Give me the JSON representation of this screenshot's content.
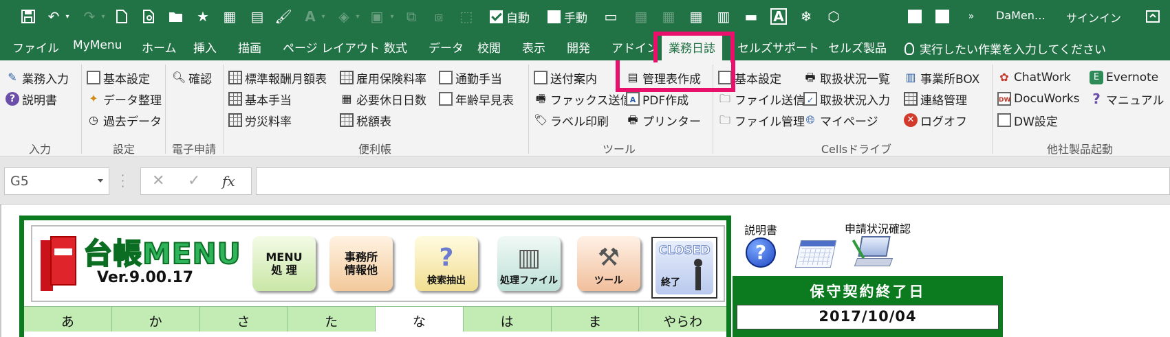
{
  "qat": {
    "checkbox_auto": "自動",
    "checkbox_manual": "手動",
    "account_name": "DaMen…",
    "signin": "サインイン"
  },
  "tabs": [
    "ファイル",
    "MyMenu",
    "ホーム",
    "挿入",
    "描画",
    "ページ レイアウト",
    "数式",
    "データ",
    "校閲",
    "表示",
    "開発",
    "アドイン",
    "業務日誌",
    "セルズサポート",
    "セルズ製品"
  ],
  "active_tab": "業務日誌",
  "tellme": "実行したい作業を入力してください",
  "ribbon": {
    "input": {
      "label": "入力",
      "items": [
        "業務入力",
        "説明書"
      ]
    },
    "settings": {
      "label": "設定",
      "items": [
        "基本設定",
        "データ整理",
        "過去データ"
      ]
    },
    "eapply": {
      "label": "電子申請",
      "items": [
        "確認"
      ]
    },
    "handbook": {
      "label": "便利帳",
      "col1": [
        "標準報酬月額表",
        "基本手当",
        "労災料率"
      ],
      "col2": [
        "雇用保険料率",
        "必要休日日数",
        "税額表"
      ],
      "col3": [
        "通勤手当",
        "年齢早見表"
      ]
    },
    "tools": {
      "label": "ツール",
      "col1": [
        "送付案内",
        "ファックス送信",
        "ラベル印刷"
      ],
      "col2": [
        "管理表作成",
        "PDF作成",
        "プリンター"
      ]
    },
    "cells_drive": {
      "label": "Cellsドライブ",
      "col1": [
        "基本設定",
        "ファイル送信",
        "ファイル管理"
      ],
      "col2": [
        "取扱状況一覧",
        "取扱状況入力",
        "マイページ"
      ],
      "col3": [
        "事業所BOX",
        "連絡管理",
        "ログオフ"
      ]
    },
    "other": {
      "label": "他社製品起動",
      "col1": [
        "ChatWork",
        "DocuWorks",
        "DW設定"
      ],
      "col2": [
        "Evernote",
        "マニュアル"
      ]
    }
  },
  "formula_bar": {
    "name_box": "G5",
    "fx": "fx",
    "value": ""
  },
  "sheet": {
    "app_title": "台帳MENU",
    "version": "Ver.9.00.17",
    "buttons": {
      "menu": [
        "MENU",
        "処 理"
      ],
      "office": [
        "事務所",
        "情報他"
      ],
      "search": "検索抽出",
      "files": "処理ファイル",
      "tools": "ツール",
      "closed_top": "CLOSED",
      "closed_bottom": "終了"
    },
    "kana": [
      "あ",
      "か",
      "さ",
      "た",
      "な",
      "は",
      "ま",
      "やらわ"
    ],
    "selected_kana": "な",
    "help_label": "説明書",
    "status_label": "申請状況確認",
    "maintenance_title": "保守契約終了日",
    "maintenance_date": "2017/10/04"
  },
  "colors": {
    "excel_green": "#217346",
    "highlight": "#e8106a",
    "menu_green": "#0c7a1e"
  }
}
